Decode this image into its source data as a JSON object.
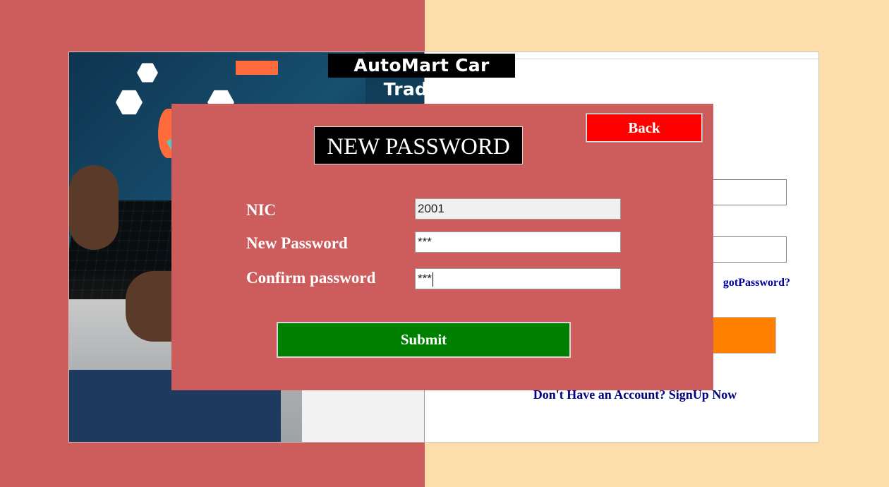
{
  "app": {
    "title": "AutoMart Car Traders"
  },
  "login": {
    "forgot_password_visible": "gotPassword?",
    "signup_link": "Don't Have an Account? SignUp Now",
    "login_button_color": "#ff7f00"
  },
  "dialog": {
    "title": "NEW PASSWORD",
    "back_label": "Back",
    "submit_label": "Submit",
    "fields": [
      {
        "label": "NIC",
        "value": "2001",
        "readonly": true
      },
      {
        "label": "New Password",
        "value": "***"
      },
      {
        "label": "Confirm password",
        "value": "***"
      }
    ]
  },
  "colors": {
    "dialog_bg": "#cd5c5c",
    "page_right_bg": "#fddeab",
    "back_button": "#ff0000",
    "submit_button": "#008000",
    "link": "#000080"
  }
}
